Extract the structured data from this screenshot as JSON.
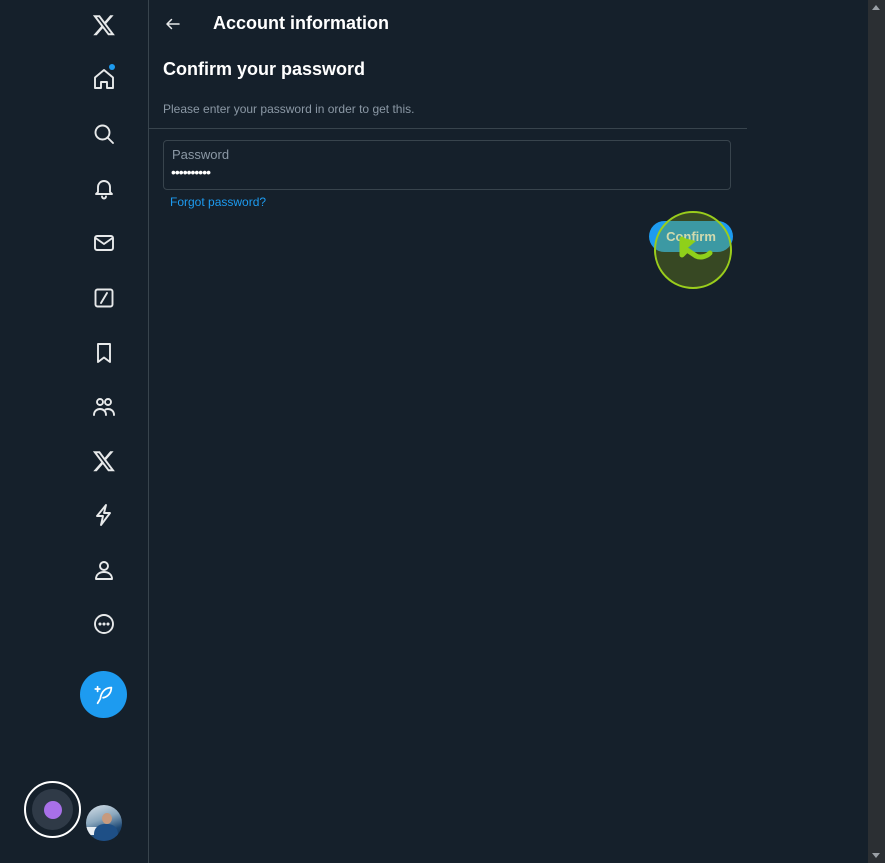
{
  "header": {
    "title": "Account information"
  },
  "section": {
    "title": "Confirm your password",
    "description": "Please enter your password in order to get this."
  },
  "password_field": {
    "label": "Password",
    "value": "••••••••••"
  },
  "links": {
    "forgot_password": "Forgot password?"
  },
  "buttons": {
    "confirm": "Confirm"
  },
  "sidebar": {
    "items": [
      {
        "icon": "x-logo-icon"
      },
      {
        "icon": "home-icon",
        "notification_dot": true
      },
      {
        "icon": "search-icon"
      },
      {
        "icon": "bell-icon"
      },
      {
        "icon": "mail-icon"
      },
      {
        "icon": "grok-icon"
      },
      {
        "icon": "bookmark-icon"
      },
      {
        "icon": "communities-icon"
      },
      {
        "icon": "premium-x-icon"
      },
      {
        "icon": "lightning-icon"
      },
      {
        "icon": "profile-icon"
      },
      {
        "icon": "more-icon"
      }
    ],
    "post_button_icon": "feather-plus-icon"
  },
  "colors": {
    "background": "#15202b",
    "accent": "#1d9bf0",
    "border": "#38444d",
    "muted_text": "#8b98a5",
    "click_highlight": "#9acd1c"
  }
}
